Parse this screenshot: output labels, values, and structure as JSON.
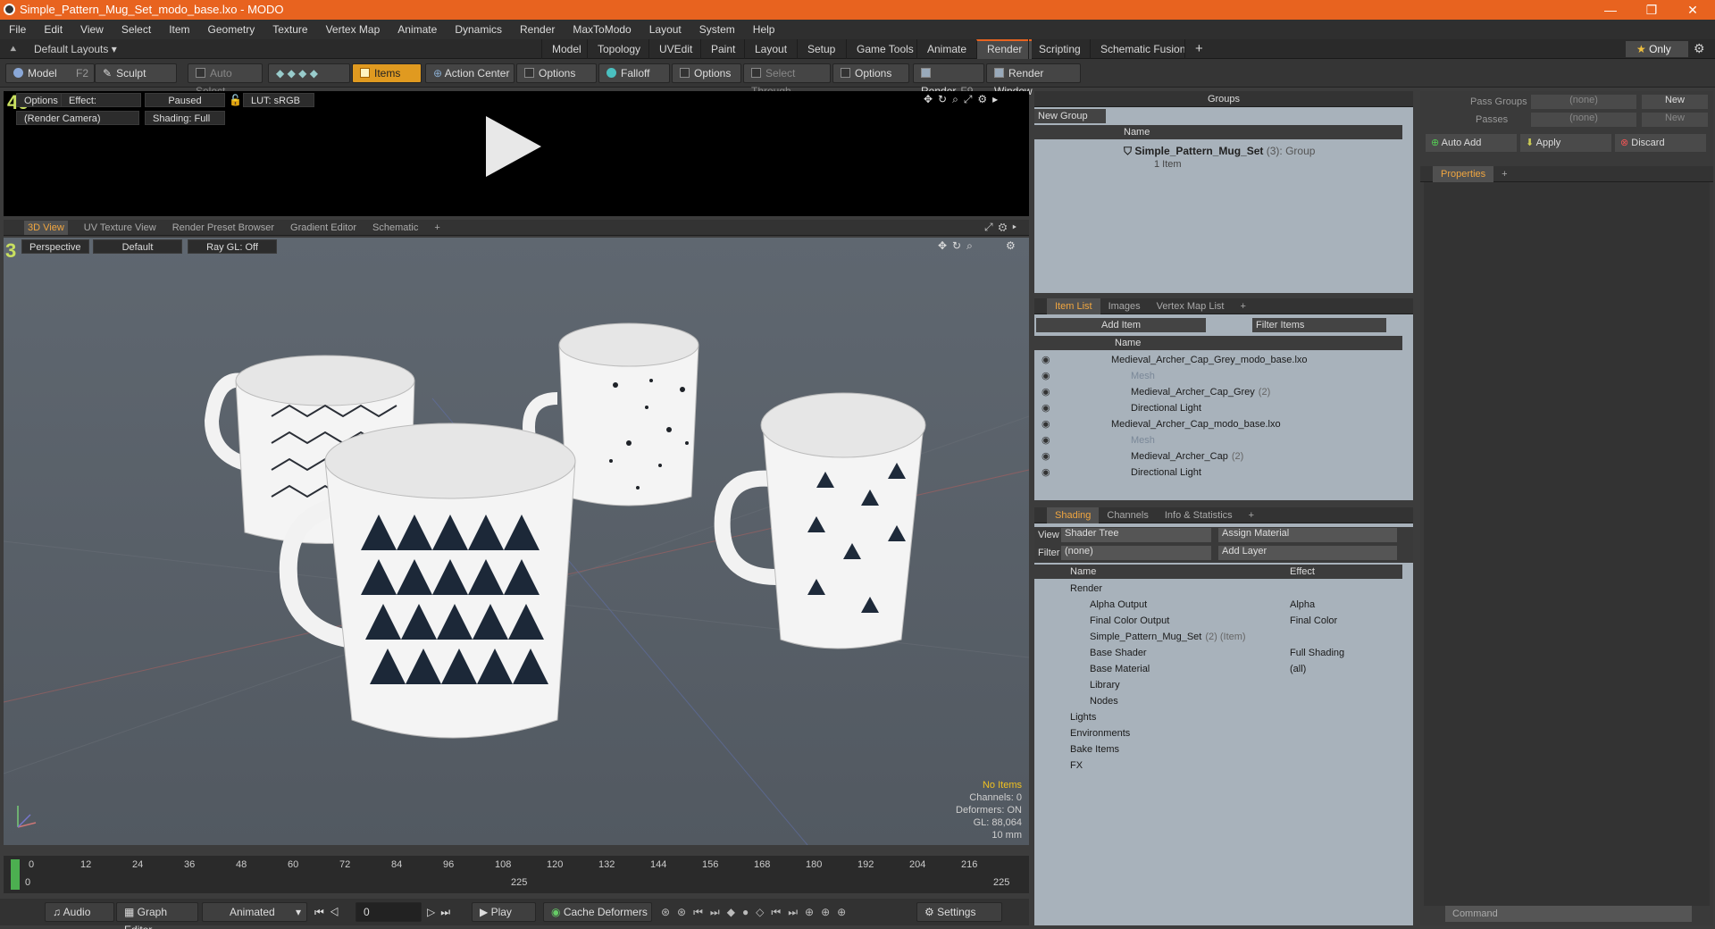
{
  "window": {
    "title": "Simple_Pattern_Mug_Set_modo_base.lxo - MODO",
    "controls": [
      "—",
      "❐",
      "✕"
    ]
  },
  "menu": [
    "File",
    "Edit",
    "View",
    "Select",
    "Item",
    "Geometry",
    "Texture",
    "Vertex Map",
    "Animate",
    "Dynamics",
    "Render",
    "MaxToModo",
    "Layout",
    "System",
    "Help"
  ],
  "layout_tabs": {
    "layouts_label": "Default Layouts ▾",
    "tabs": [
      "Model",
      "Topology",
      "UVEdit",
      "Paint",
      "Layout",
      "Setup",
      "Game Tools",
      "Animate",
      "Render",
      "Scripting",
      "Schematic Fusion",
      "+"
    ],
    "active": "Render",
    "only_label": "Only"
  },
  "toolbar": {
    "model": "Model",
    "model_key": "F2",
    "sculpt": "Sculpt",
    "auto_select": "Auto Select",
    "items": "Items",
    "action_center": "Action Center",
    "options1": "Options",
    "falloff": "Falloff",
    "options2": "Options",
    "select_through": "Select Through",
    "options3": "Options",
    "render": "Render",
    "render_key": "F9",
    "render_window": "Render Window"
  },
  "render_view": {
    "options": "Options",
    "effect": "Effect: (Shadi...",
    "paused": "Paused",
    "lut": "LUT: sRGB",
    "camera": "(Render Camera)",
    "shading": "Shading: Full"
  },
  "viewport_tabs": {
    "tabs": [
      "3D View",
      "UV Texture View",
      "Render Preset Browser",
      "Gradient Editor",
      "Schematic",
      "+"
    ],
    "active": "3D View"
  },
  "viewport": {
    "perspective": "Perspective",
    "default": "Default",
    "raygl": "Ray GL: Off",
    "stats": {
      "items": "No Items",
      "channels": "Channels: 0",
      "deformers": "Deformers: ON",
      "gl": "GL: 88,064",
      "scale": "10 mm"
    }
  },
  "groups": {
    "title": "Groups",
    "new_group": "New Group",
    "col_name": "Name",
    "group_name": "Simple_Pattern_Mug_Set",
    "group_count": "(3)",
    "group_type": ": Group",
    "group_sub": "1 Item"
  },
  "item_list": {
    "tabs": [
      "Item List",
      "Images",
      "Vertex Map List",
      "+"
    ],
    "add_item": "Add Item",
    "filter": "Filter Items",
    "col_name": "Name",
    "rows": [
      {
        "label": "Medieval_Archer_Cap_Grey_modo_base.lxo",
        "indent": 0,
        "dim": false
      },
      {
        "label": "Mesh",
        "indent": 1,
        "dim": true
      },
      {
        "label": "Medieval_Archer_Cap_Grey",
        "suffix": "(2)",
        "indent": 1,
        "dim": false
      },
      {
        "label": "Directional Light",
        "indent": 1,
        "dim": false
      },
      {
        "label": "Medieval_Archer_Cap_modo_base.lxo",
        "indent": 0,
        "dim": false
      },
      {
        "label": "Mesh",
        "indent": 1,
        "dim": true
      },
      {
        "label": "Medieval_Archer_Cap",
        "suffix": "(2)",
        "indent": 1,
        "dim": false
      },
      {
        "label": "Directional Light",
        "indent": 1,
        "dim": false
      }
    ]
  },
  "shading": {
    "tabs": [
      "Shading",
      "Channels",
      "Info & Statistics",
      "+"
    ],
    "view_label": "View",
    "view_value": "Shader Tree",
    "assign": "Assign Material",
    "filter_label": "Filter",
    "filter_value": "(none)",
    "add_layer": "Add Layer",
    "col_name": "Name",
    "col_effect": "Effect",
    "rows": [
      {
        "label": "Render",
        "effect": "",
        "indent": 0
      },
      {
        "label": "Alpha Output",
        "effect": "Alpha",
        "indent": 1
      },
      {
        "label": "Final Color Output",
        "effect": "Final Color",
        "indent": 1
      },
      {
        "label": "Simple_Pattern_Mug_Set",
        "suffix": "(2) (Item)",
        "effect": "",
        "indent": 1
      },
      {
        "label": "Base Shader",
        "effect": "Full Shading",
        "indent": 1
      },
      {
        "label": "Base Material",
        "effect": "(all)",
        "indent": 1
      },
      {
        "label": "Library",
        "effect": "",
        "indent": 1
      },
      {
        "label": "Nodes",
        "effect": "",
        "indent": 1
      },
      {
        "label": "Lights",
        "effect": "",
        "indent": 0
      },
      {
        "label": "Environments",
        "effect": "",
        "indent": 0
      },
      {
        "label": "Bake Items",
        "effect": "",
        "indent": 0
      },
      {
        "label": "FX",
        "effect": "",
        "indent": 0
      }
    ]
  },
  "properties": {
    "pass_groups": "Pass Groups",
    "pass_groups_value": "(none)",
    "passes": "Passes",
    "passes_value": "(none)",
    "new": "New",
    "auto_add": "Auto Add",
    "apply": "Apply",
    "discard": "Discard",
    "tab": "Properties"
  },
  "timeline": {
    "ticks": [
      "0",
      "12",
      "24",
      "36",
      "48",
      "60",
      "72",
      "84",
      "96",
      "108",
      "120",
      "132",
      "144",
      "156",
      "168",
      "180",
      "192",
      "204",
      "216"
    ],
    "start": "0",
    "mid": "225",
    "end": "225"
  },
  "bottom": {
    "audio": "Audio",
    "graph_editor": "Graph Editor",
    "animated": "Animated",
    "frame": "0",
    "play": "Play",
    "cache": "Cache Deformers",
    "settings": "Settings",
    "command": "Command"
  }
}
